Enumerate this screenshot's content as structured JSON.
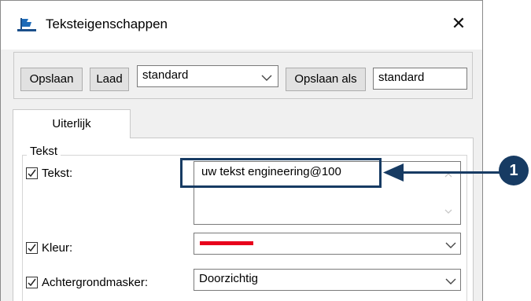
{
  "window": {
    "title": "Teksteigenschappen",
    "app_icon": "flag-icon",
    "close_icon": "close-icon",
    "close_glyph": "✕"
  },
  "toolbar": {
    "save_label": "Opslaan",
    "load_label": "Laad",
    "preset_value": "standard",
    "save_as_label": "Opslaan als",
    "save_as_name": "standard"
  },
  "tabs": [
    {
      "label": "Uiterlijk",
      "active": true
    }
  ],
  "group": {
    "label": "Tekst"
  },
  "rows": {
    "text": {
      "label": "Tekst:",
      "checked": true,
      "value": "uw tekst engineering@100"
    },
    "color": {
      "label": "Kleur:",
      "checked": true,
      "value_color": "#e8001c"
    },
    "mask": {
      "label": "Achtergrondmasker:",
      "checked": true,
      "value": "Doorzichtig"
    }
  },
  "annotation": {
    "number": "1",
    "color": "#173b63"
  }
}
